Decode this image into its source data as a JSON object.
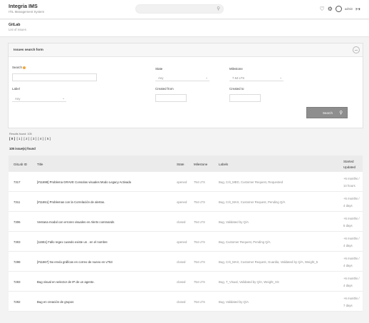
{
  "app": {
    "title": "Integria IMS",
    "subtitle": "ITIL Management System",
    "user": "admin"
  },
  "header": {
    "title": "GitLab",
    "subtitle": "List of issues"
  },
  "form": {
    "heading": "Issues search form",
    "search_label": "Search",
    "state_label": "State",
    "state_value": "Any",
    "milestone_label": "Milestone",
    "milestone_value": "7.54 LTS",
    "label_label": "Label",
    "label_value": "Any",
    "created_from_label": "Created from",
    "created_to_label": "Created to",
    "search_button": "Search"
  },
  "results": {
    "info": "Results found: 105",
    "pages": [
      "[ 0 ]",
      "[ 1 ]",
      "[ 2 ]",
      "[ 3 ]",
      "[ 4 ]",
      "[ 5 ]"
    ],
    "count": "105 issue(s) found"
  },
  "table": {
    "headers": {
      "id": "GitLab ID",
      "title": "Title",
      "state": "State",
      "milestone": "Milestone",
      "labels": "Labels",
      "started": "Started",
      "updated": "Updated"
    },
    "rows": [
      {
        "id": "7317",
        "title": "[#11698] Problema GRAVE Consolas visuales Modo Legacy Activado",
        "state": "opened",
        "milestone": "754 LTS",
        "labels": "Bug, Crit_MED, Customer Request, Requested",
        "started": "+6 months /",
        "updated": "14 hours"
      },
      {
        "id": "7311",
        "title": "[#11651] Problemas con la Correlación de alertas.",
        "state": "opened",
        "milestone": "754 LTS",
        "labels": "Bug, Crit_MAX, Customer Request, Pending Q/A",
        "started": "+6 months /",
        "updated": "4 days"
      },
      {
        "id": "7306",
        "title": "Ventana modal con errores visuales en Alerts commands",
        "state": "closed",
        "milestone": "754 LTS",
        "labels": "Bug, Validated by Q/A",
        "started": "+6 months /",
        "updated": "5 days"
      },
      {
        "id": "7303",
        "title": "[11651] Fallo regex cuando existe un . en el nombre",
        "state": "opened",
        "milestone": "754 LTS",
        "labels": "Bug, Customer Request, Pending Q/A",
        "started": "+6 months /",
        "updated": "4 days"
      },
      {
        "id": "7298",
        "title": "[#11667] No envía gráficas en correo de nuevo en v753",
        "state": "closed",
        "milestone": "754 LTS",
        "labels": "Bug, Crit_MAX, Customer Request, Guardia, Validated by Q/A, Weight_5",
        "started": "+6 months /",
        "updated": "4 days"
      },
      {
        "id": "7293",
        "title": "Bug visual en selector de IP de un agente.",
        "state": "closed",
        "milestone": "754 LTS",
        "labels": "Bug, T_Visual, Validated by Q/A, Weight_XS",
        "started": "+6 months /",
        "updated": "4 days"
      },
      {
        "id": "7292",
        "title": "Bug en creación de grupos",
        "state": "closed",
        "milestone": "754 LTS",
        "labels": "Bug, Validated by Q/A",
        "started": "+6 months /",
        "updated": "7 days"
      }
    ]
  }
}
